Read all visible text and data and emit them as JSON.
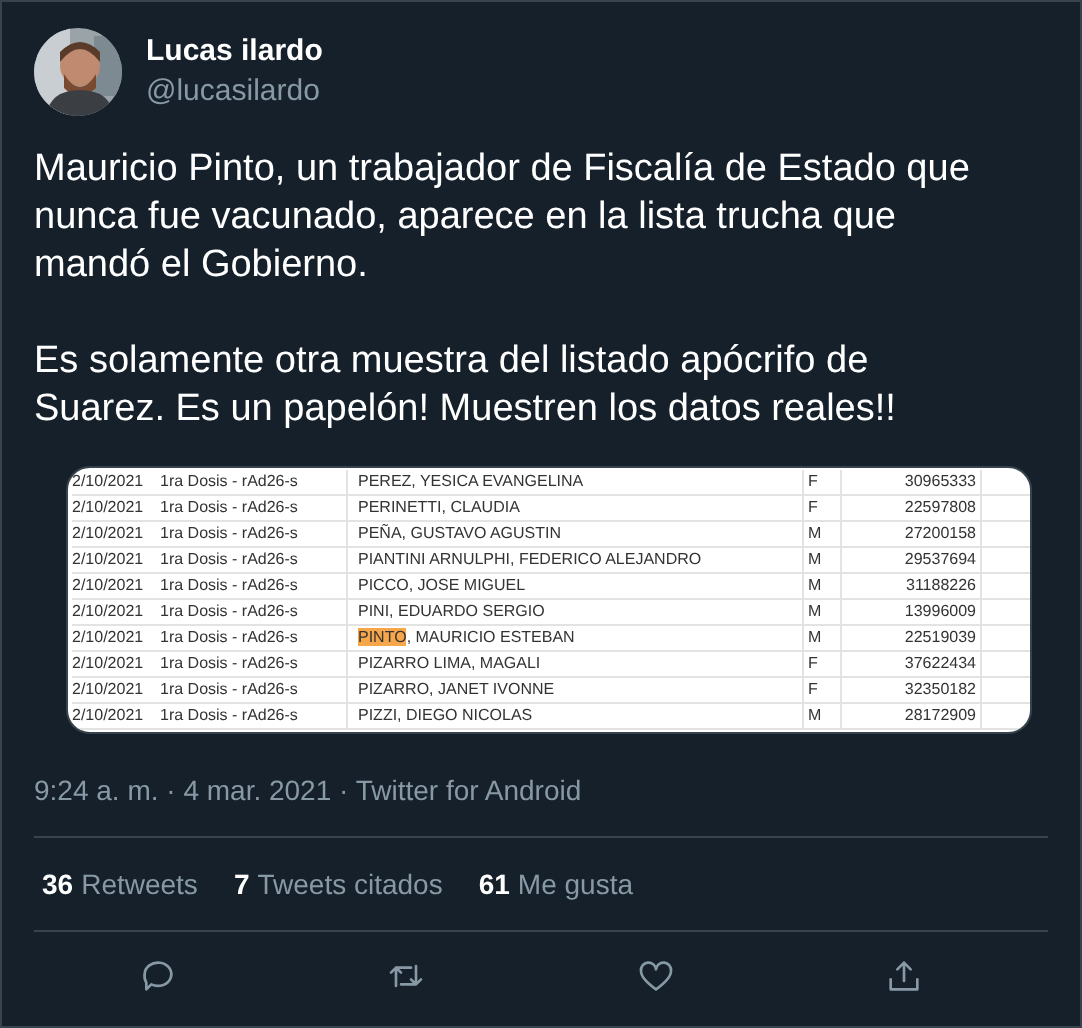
{
  "author": {
    "name": "Lucas ilardo",
    "handle": "@lucasilardo"
  },
  "text": "Mauricio Pinto, un trabajador de Fiscalía de Estado que\nnunca fue vacunado, aparece en la lista trucha que\nmandó el Gobierno.\n\nEs solamente otra muestra del listado apócrifo de\nSuarez. Es un papelón! Muestren los datos reales!!",
  "attachment": {
    "rows": [
      {
        "date": "2/10/2021",
        "dose": "1ra Dosis - rAd26-s",
        "name_parts": [
          {
            "text": "PEREZ, YESICA EVANGELINA",
            "highlighted": false
          }
        ],
        "sex": "F",
        "id": "30965333"
      },
      {
        "date": "2/10/2021",
        "dose": "1ra Dosis - rAd26-s",
        "name_parts": [
          {
            "text": "PERINETTI, CLAUDIA",
            "highlighted": false
          }
        ],
        "sex": "F",
        "id": "22597808"
      },
      {
        "date": "2/10/2021",
        "dose": "1ra Dosis - rAd26-s",
        "name_parts": [
          {
            "text": "PEÑA, GUSTAVO AGUSTIN",
            "highlighted": false
          }
        ],
        "sex": "M",
        "id": "27200158"
      },
      {
        "date": "2/10/2021",
        "dose": "1ra Dosis - rAd26-s",
        "name_parts": [
          {
            "text": "PIANTINI ARNULPHI, FEDERICO ALEJANDRO",
            "highlighted": false
          }
        ],
        "sex": "M",
        "id": "29537694"
      },
      {
        "date": "2/10/2021",
        "dose": "1ra Dosis - rAd26-s",
        "name_parts": [
          {
            "text": "PICCO, JOSE MIGUEL",
            "highlighted": false
          }
        ],
        "sex": "M",
        "id": "31188226"
      },
      {
        "date": "2/10/2021",
        "dose": "1ra Dosis - rAd26-s",
        "name_parts": [
          {
            "text": "PINI, EDUARDO SERGIO",
            "highlighted": false
          }
        ],
        "sex": "M",
        "id": "13996009"
      },
      {
        "date": "2/10/2021",
        "dose": "1ra Dosis - rAd26-s",
        "name_parts": [
          {
            "text": "PINTO",
            "highlighted": true
          },
          {
            "text": ", MAURICIO ESTEBAN",
            "highlighted": false
          }
        ],
        "sex": "M",
        "id": "22519039"
      },
      {
        "date": "2/10/2021",
        "dose": "1ra Dosis - rAd26-s",
        "name_parts": [
          {
            "text": "PIZARRO LIMA, MAGALI",
            "highlighted": false
          }
        ],
        "sex": "F",
        "id": "37622434"
      },
      {
        "date": "2/10/2021",
        "dose": "1ra Dosis - rAd26-s",
        "name_parts": [
          {
            "text": "PIZARRO, JANET IVONNE",
            "highlighted": false
          }
        ],
        "sex": "F",
        "id": "32350182"
      },
      {
        "date": "2/10/2021",
        "dose": "1ra Dosis - rAd26-s",
        "name_parts": [
          {
            "text": "PIZZI, DIEGO NICOLAS",
            "highlighted": false
          }
        ],
        "sex": "M",
        "id": "28172909"
      }
    ]
  },
  "timestamp": "9:24 a. m. · 4 mar. 2021 · Twitter for Android",
  "stats": [
    {
      "count": "36",
      "label": "Retweets"
    },
    {
      "count": "7",
      "label": "Tweets citados"
    },
    {
      "count": "61",
      "label": "Me gusta"
    }
  ],
  "actions": [
    {
      "kind": "reply"
    },
    {
      "kind": "retweet"
    },
    {
      "kind": "like"
    },
    {
      "kind": "share"
    }
  ]
}
